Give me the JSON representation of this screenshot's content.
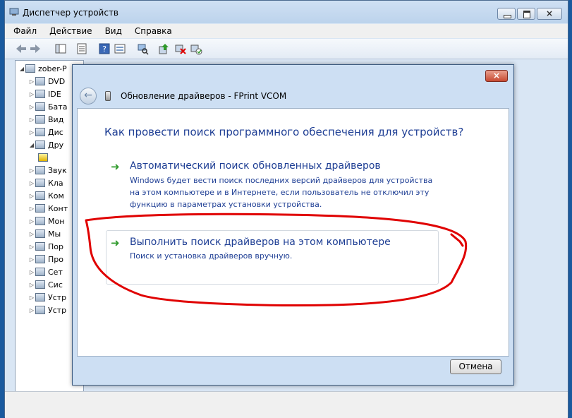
{
  "window": {
    "title": "Диспетчер устройств",
    "controls": {
      "minimize": "",
      "maximize": "",
      "close": "×"
    }
  },
  "menu": [
    "Файл",
    "Действие",
    "Вид",
    "Справка"
  ],
  "tree": {
    "root": "zober-P",
    "items": [
      "DVD",
      "IDE",
      "Бата",
      "Вид",
      "Дис",
      "Дру",
      "",
      "Звук",
      "Кла",
      "Ком",
      "Конт",
      "Мон",
      "Мы",
      "Пор",
      "Про",
      "Сет",
      "Сис",
      "Устр",
      "Устр"
    ]
  },
  "dialog": {
    "close": "×",
    "back": "←",
    "title": "Обновление драйверов - FPrint VCOM",
    "question": "Как провести поиск программного обеспечения для устройств?",
    "option1": {
      "arrow": "➜",
      "title": "Автоматический поиск обновленных драйверов",
      "desc": "Windows будет вести поиск последних версий драйверов для устройства на этом компьютере и в Интернете, если пользователь не отключил эту функцию в параметрах установки устройства."
    },
    "option2": {
      "arrow": "➜",
      "title": "Выполнить поиск драйверов на этом компьютере",
      "desc": "Поиск и установка драйверов вручную."
    },
    "cancel": "Отмена"
  },
  "colors": {
    "link_blue": "#1e3e94",
    "arrow_green": "#2f9a2b",
    "red_mark": "#e00000"
  }
}
